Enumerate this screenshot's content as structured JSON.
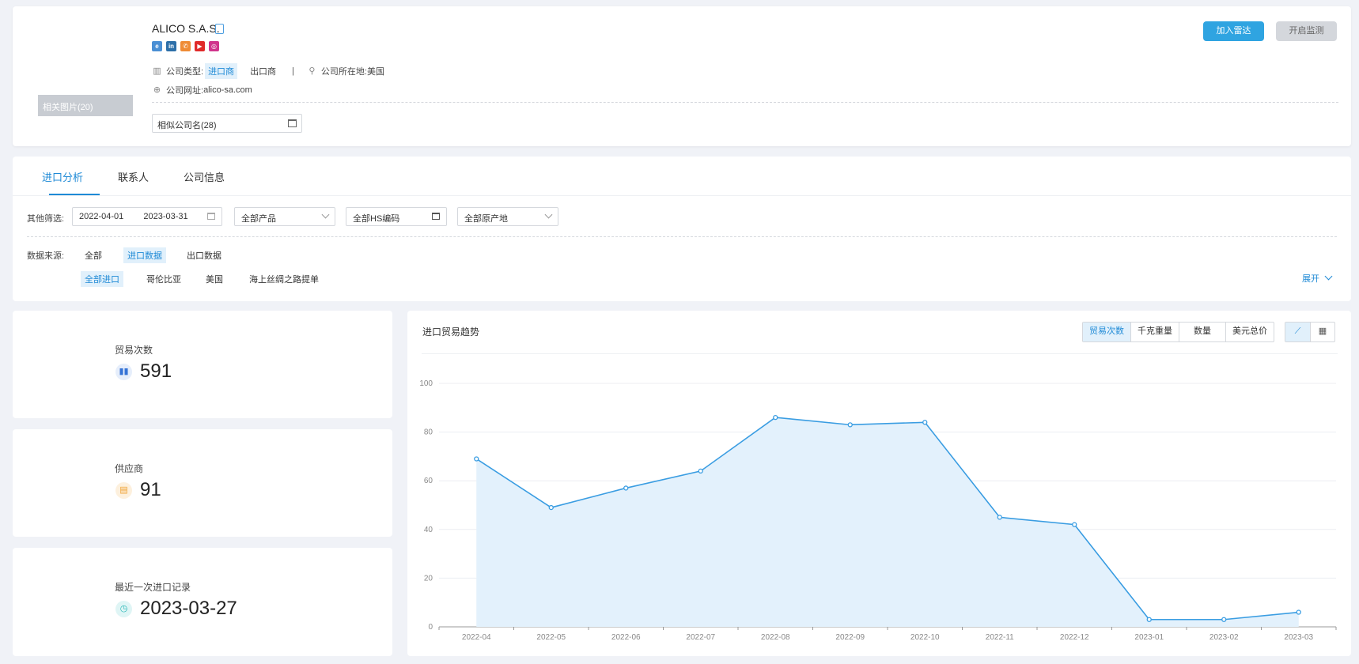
{
  "header": {
    "photo_label": "相关图片(20)",
    "company_name": "ALICO S.A.S.",
    "socials": [
      "ie-icon",
      "linkedin-icon",
      "phone-icon",
      "youtube-icon",
      "instagram-icon"
    ],
    "company_type_label": "公司类型:",
    "company_type_active": "进口商",
    "company_type_other": "出口商",
    "separator": "|",
    "location_label": "公司所在地:",
    "location_value": "美国",
    "website_label": "公司网址:",
    "website_value": "alico-sa.com",
    "similar_names": "相似公司名(28)",
    "add_radar": "加入雷达",
    "start_monitor": "开启监测"
  },
  "tabs": [
    "进口分析",
    "联系人",
    "公司信息"
  ],
  "filters": {
    "label": "其他筛选:",
    "date_start": "2022-04-01",
    "date_end": "2023-03-31",
    "product": "全部产品",
    "hs_code": "全部HS编码",
    "origin": "全部原产地"
  },
  "data_source": {
    "label": "数据来源:",
    "options": [
      "全部",
      "进口数据",
      "出口数据"
    ],
    "sub_options": [
      "全部进口",
      "哥伦比亚",
      "美国",
      "海上丝绸之路提单"
    ],
    "expand": "展开"
  },
  "stats": [
    {
      "label": "贸易次数",
      "value": "591",
      "icon": "bar-chart-icon"
    },
    {
      "label": "供应商",
      "value": "91",
      "icon": "supplier-icon"
    },
    {
      "label": "最近一次进口记录",
      "value": "2023-03-27",
      "icon": "clock-icon"
    }
  ],
  "chart_panel": {
    "title": "进口贸易趋势",
    "metrics": [
      "贸易次数",
      "千克重量",
      "数量",
      "美元总价"
    ],
    "views": [
      "line-chart-icon",
      "table-icon"
    ]
  },
  "colors": {
    "accent": "#2fa4e1",
    "line": "#3a9de2",
    "area": "#e3f1fc"
  },
  "chart_data": {
    "type": "area",
    "x": [
      "2022-04",
      "2022-05",
      "2022-06",
      "2022-07",
      "2022-08",
      "2022-09",
      "2022-10",
      "2022-11",
      "2022-12",
      "2023-01",
      "2023-02",
      "2023-03"
    ],
    "values": [
      69,
      49,
      57,
      64,
      86,
      83,
      84,
      45,
      42,
      3,
      3,
      6
    ],
    "yticks": [
      "0",
      "20",
      "40",
      "60",
      "80",
      "100"
    ],
    "ylim": [
      0,
      100
    ],
    "grid": true
  }
}
